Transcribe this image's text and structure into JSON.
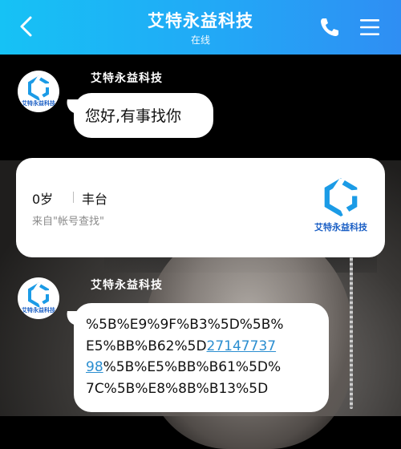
{
  "header": {
    "title": "艾特永益科技",
    "subtitle": "在线"
  },
  "messages": [
    {
      "sender": "艾特永益科技",
      "avatar_text": "艾特永益科技",
      "text": "您好,有事找你"
    },
    {
      "sender": "艾特永益科技",
      "avatar_text": "艾特永益科技",
      "lines": [
        {
          "plain": "%5B%E9%9F%B3%5D%5B%",
          "link": ""
        },
        {
          "plain": "E5%BB%B62%5D",
          "link": "27147737"
        },
        {
          "link": "98",
          "plain": "%5B%E5%BB%B61%5D%"
        },
        {
          "plain": "7C%5B%E8%8B%B13%5D",
          "link": ""
        }
      ]
    }
  ],
  "profile_card": {
    "age": "0岁",
    "location": "丰台",
    "from": "来自\"帐号查找\"",
    "logo_text": "艾特永益科技"
  },
  "colors": {
    "header_start": "#16c2f5",
    "header_end": "#2f8ef3",
    "logo_blue": "#1b5fc5",
    "link": "#2b8ed0"
  },
  "icons": [
    "back-chevron-icon",
    "phone-icon",
    "menu-icon",
    "company-logo-icon"
  ]
}
